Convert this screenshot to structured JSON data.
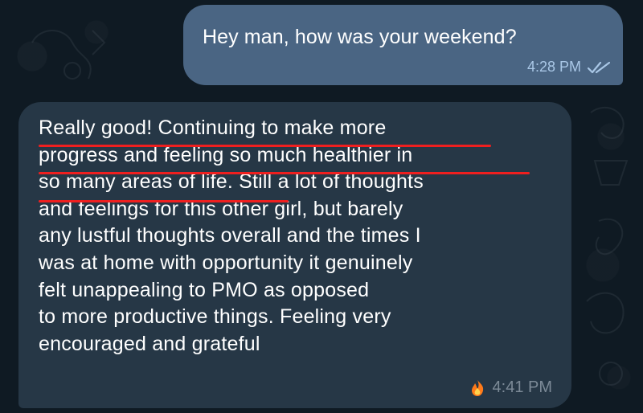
{
  "messages": {
    "outgoing": {
      "text": "Hey man, how was your weekend?",
      "time": "4:28 PM",
      "status_icon": "double-check-icon"
    },
    "incoming": {
      "text": "Really good! Continuing to make more\nprogress and feeling so much healthier in\nso many areas of life. Still a lot of thoughts\nand feelings for this other girl, but barely\nany lustful thoughts overall and the times I\nwas at home with opportunity it genuinely\nfelt unappealing to PMO as opposed\nto more productive things. Feeling very\nencouraged and grateful",
      "time": "4:41 PM",
      "reaction_icon": "fire-icon"
    }
  },
  "colors": {
    "background": "#0f1a23",
    "outgoing_bubble": "#4a6583",
    "incoming_bubble": "#263746",
    "underline": "#ef1f1f"
  }
}
